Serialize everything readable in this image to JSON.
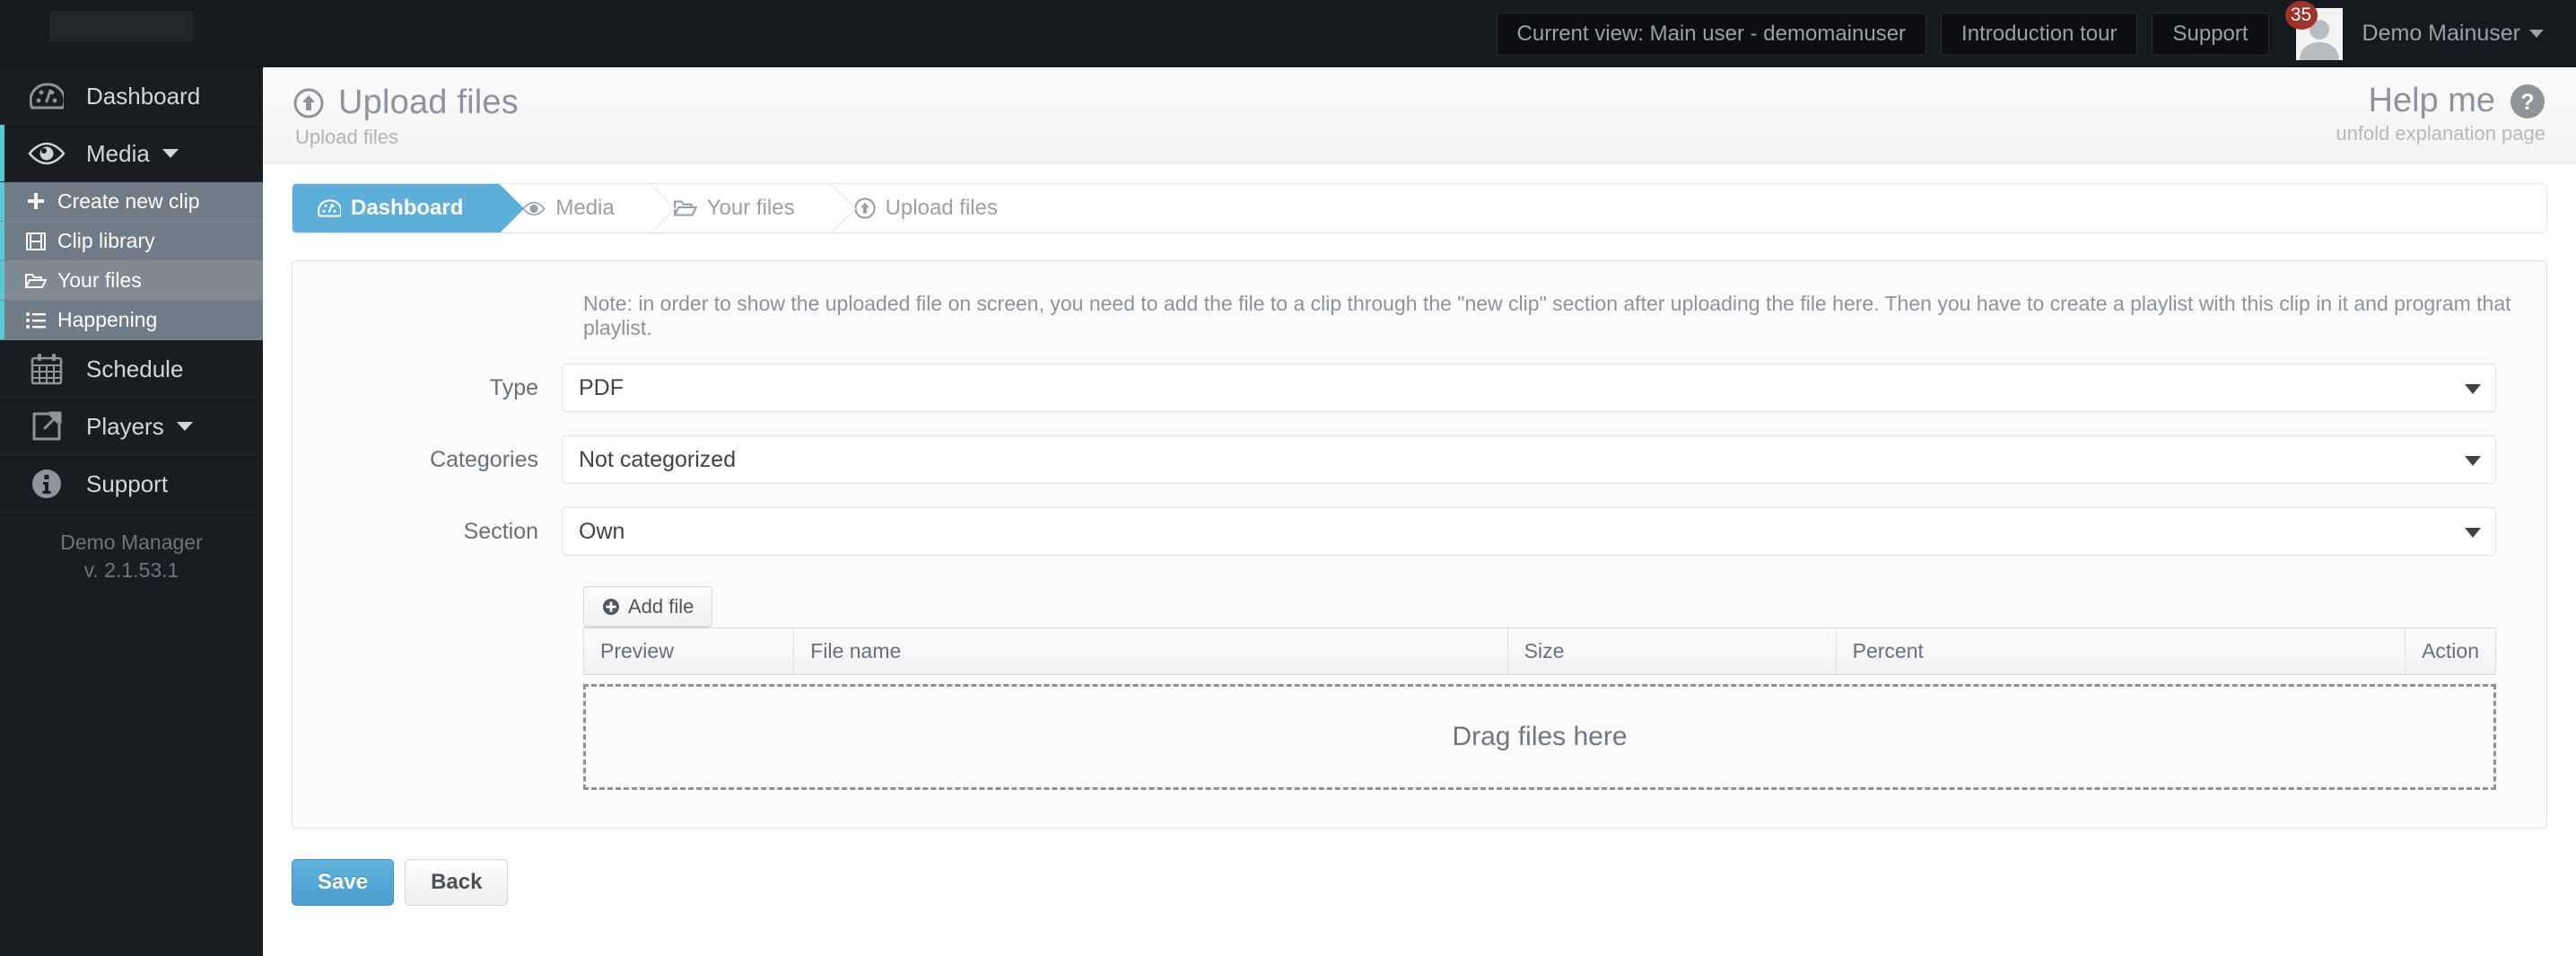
{
  "topbar": {
    "current_view": "Current view: Main user - demomainuser",
    "intro_tour": "Introduction tour",
    "support": "Support",
    "notification_count": "35",
    "user_name": "Demo Mainuser"
  },
  "sidebar": {
    "items": [
      {
        "label": "Dashboard",
        "icon": "dashboard-icon"
      },
      {
        "label": "Media",
        "icon": "eye-icon",
        "has_caret": true
      }
    ],
    "subitems": [
      {
        "label": "Create new clip",
        "icon": "plus-icon"
      },
      {
        "label": "Clip library",
        "icon": "film-icon"
      },
      {
        "label": "Your files",
        "icon": "folder-open-icon",
        "selected": true
      },
      {
        "label": "Happening",
        "icon": "list-icon"
      }
    ],
    "items_after": [
      {
        "label": "Schedule",
        "icon": "calendar-icon",
        "has_caret": true
      },
      {
        "label": "Players",
        "icon": "external-link-icon",
        "has_caret": true
      },
      {
        "label": "Support",
        "icon": "info-circle-icon"
      }
    ],
    "footer_product": "Demo Manager",
    "footer_version": "v. 2.1.53.1"
  },
  "page_header": {
    "title": "Upload files",
    "subtitle": "Upload files",
    "help_title": "Help me",
    "help_subtitle": "unfold explanation page"
  },
  "breadcrumbs": [
    {
      "label": "Dashboard",
      "icon": "dashboard-icon"
    },
    {
      "label": "Media",
      "icon": "eye-icon"
    },
    {
      "label": "Your files",
      "icon": "folder-open-icon"
    },
    {
      "label": "Upload files",
      "icon": "upload-circle-icon"
    }
  ],
  "form": {
    "note": "Note: in order to show the uploaded file on screen, you need to add the file to a clip through the \"new clip\" section after uploading the file here. Then you have to create a playlist with this clip in it and program that playlist.",
    "fields": [
      {
        "label": "Type",
        "value": "PDF"
      },
      {
        "label": "Categories",
        "value": "Not categorized"
      },
      {
        "label": "Section",
        "value": "Own"
      }
    ]
  },
  "uploader": {
    "add_file_label": "Add file",
    "columns": [
      "Preview",
      "File name",
      "Size",
      "Percent",
      "Action"
    ],
    "dropzone_text": "Drag files here"
  },
  "actions": {
    "save_label": "Save",
    "back_label": "Back"
  },
  "colors": {
    "accent": "#5daed9",
    "sidebar_bg": "#191c21",
    "submenu_bg": "#6f7b85",
    "active_marker": "#5bc8d6",
    "badge": "#9c342b"
  }
}
